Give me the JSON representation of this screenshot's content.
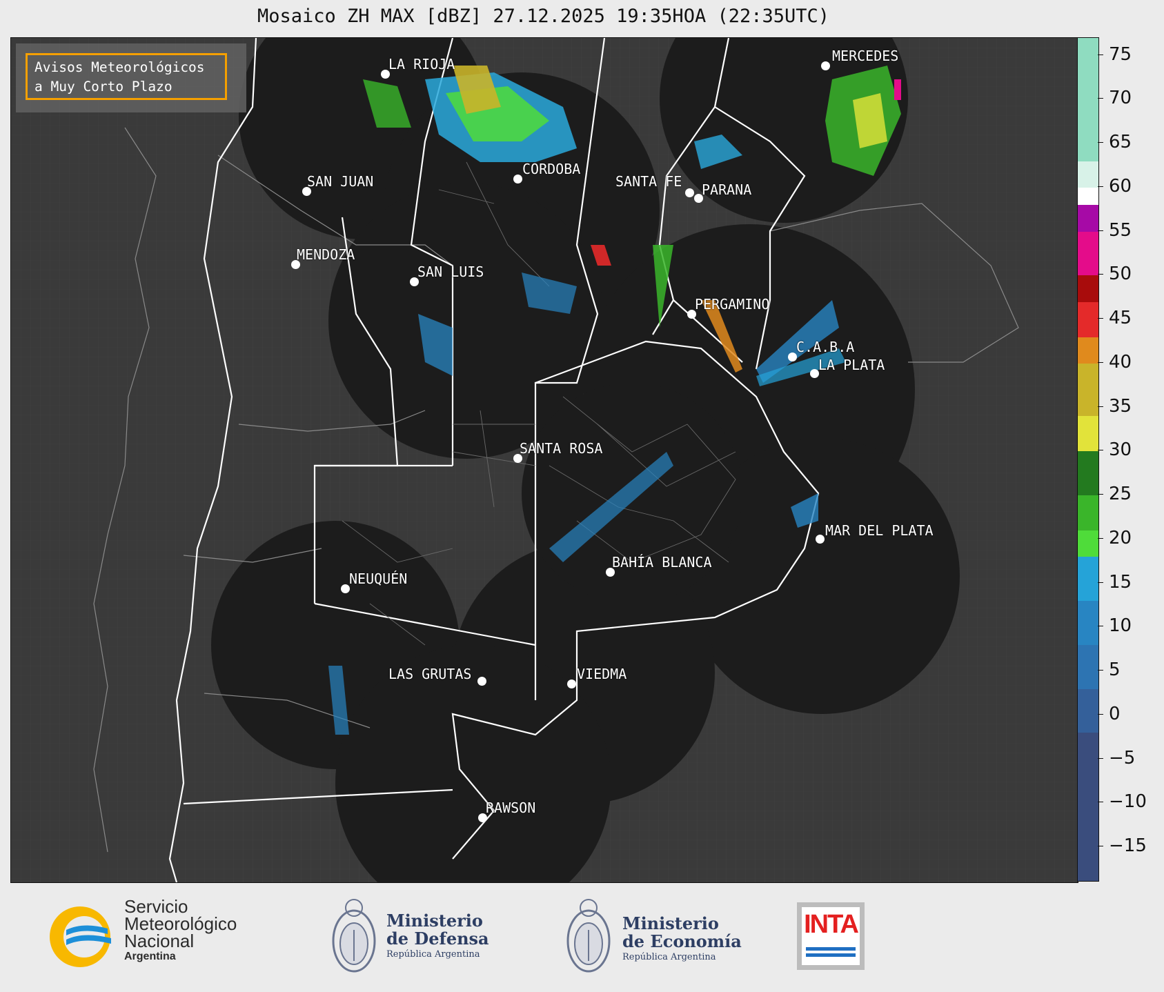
{
  "title": "Mosaico ZH MAX [dBZ] 27.12.2025 19:35HOA (22:35UTC)",
  "notice": {
    "line1": "Avisos Meteorológicos",
    "line2": "a Muy Corto Plazo",
    "border_color": "#f5a000"
  },
  "cities": [
    {
      "name": "LA RIOJA"
    },
    {
      "name": "MERCEDES"
    },
    {
      "name": "CORDOBA"
    },
    {
      "name": "SAN JUAN"
    },
    {
      "name": "SANTA FE"
    },
    {
      "name": "PARANA"
    },
    {
      "name": "MENDOZA"
    },
    {
      "name": "SAN LUIS"
    },
    {
      "name": "PERGAMINO"
    },
    {
      "name": "C.A.B.A"
    },
    {
      "name": "LA PLATA"
    },
    {
      "name": "SANTA ROSA"
    },
    {
      "name": "MAR DEL PLATA"
    },
    {
      "name": "BAHÍA BLANCA"
    },
    {
      "name": "NEUQUÉN"
    },
    {
      "name": "LAS GRUTAS"
    },
    {
      "name": "VIEDMA"
    },
    {
      "name": "RAWSON"
    }
  ],
  "colorbar": {
    "range": [
      -19,
      77
    ],
    "ticks": [
      "75",
      "70",
      "65",
      "60",
      "55",
      "50",
      "45",
      "40",
      "35",
      "30",
      "25",
      "20",
      "15",
      "10",
      "5",
      "0",
      "−5",
      "−10",
      "−15"
    ],
    "segments": [
      {
        "from": -19,
        "to": -2,
        "color": "#3a4d7d"
      },
      {
        "from": -2,
        "to": 3,
        "color": "#34609a"
      },
      {
        "from": 3,
        "to": 8,
        "color": "#2d74b2"
      },
      {
        "from": 8,
        "to": 13,
        "color": "#2885c2"
      },
      {
        "from": 13,
        "to": 18,
        "color": "#25a3d8"
      },
      {
        "from": 18,
        "to": 21,
        "color": "#4fdc3a"
      },
      {
        "from": 21,
        "to": 25,
        "color": "#3ab52a"
      },
      {
        "from": 25,
        "to": 30,
        "color": "#237a1f"
      },
      {
        "from": 30,
        "to": 34,
        "color": "#e2e33a"
      },
      {
        "from": 34,
        "to": 40,
        "color": "#c9b42a"
      },
      {
        "from": 40,
        "to": 43,
        "color": "#e08a1d"
      },
      {
        "from": 43,
        "to": 47,
        "color": "#e42a2a"
      },
      {
        "from": 47,
        "to": 50,
        "color": "#a80c0c"
      },
      {
        "from": 50,
        "to": 55,
        "color": "#e40c8a"
      },
      {
        "from": 55,
        "to": 58,
        "color": "#a60aa6"
      },
      {
        "from": 58,
        "to": 60,
        "color": "#ffffff"
      },
      {
        "from": 60,
        "to": 63,
        "color": "#d8f2e8"
      },
      {
        "from": 63,
        "to": 77,
        "color": "#8fdcc0"
      }
    ]
  },
  "logos": {
    "smn": {
      "line1": "Servicio",
      "line2": "Meteorológico",
      "line3": "Nacional",
      "line4": "Argentina"
    },
    "defensa": {
      "line1": "Ministerio",
      "line2": "de Defensa",
      "line3": "República Argentina"
    },
    "economia": {
      "line1": "Ministerio",
      "line2": "de Economía",
      "line3": "República Argentina"
    },
    "inta": {
      "text": "INTA"
    }
  },
  "colors": {
    "radar_coverage": "#1c1c1c",
    "background": "#3a3a3a",
    "borders": "#ffffff"
  }
}
